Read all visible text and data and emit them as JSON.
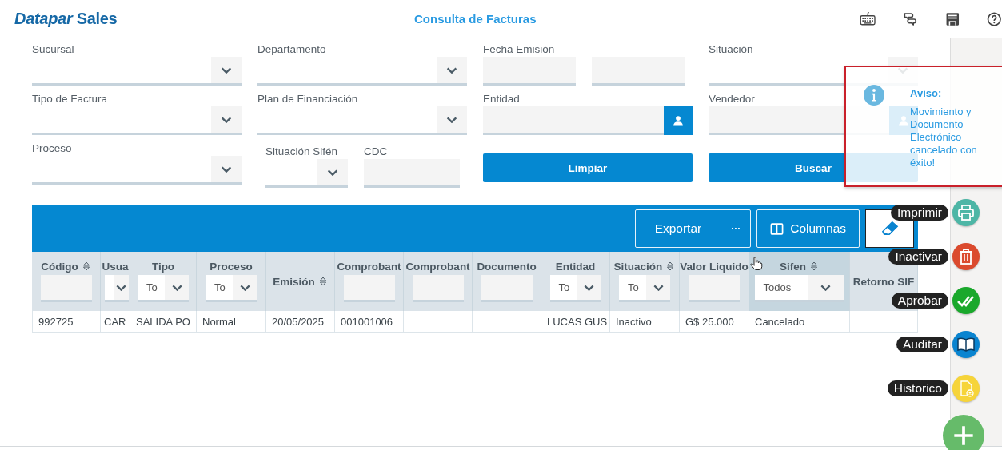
{
  "header": {
    "logo": "*Datapar* Sales",
    "title": "Consulta de Facturas"
  },
  "filters": [
    {
      "kind": "select",
      "label": "Sucursal"
    },
    {
      "kind": "select",
      "label": "Departamento"
    },
    {
      "kind": "date_range",
      "label": "Fecha Emisión"
    },
    {
      "kind": "select",
      "label": "Situación"
    },
    {
      "kind": "select",
      "label": "Tipo de Factura"
    },
    {
      "kind": "select",
      "label": "Plan de Financiación"
    },
    {
      "kind": "lookup",
      "label": "Entidad"
    },
    {
      "kind": "lookup",
      "label": "Vendedor"
    },
    {
      "kind": "select",
      "label": "Proceso"
    },
    {
      "kind": "split",
      "fields": [
        {
          "kind": "select",
          "label": "Situación Sifén"
        },
        {
          "kind": "text",
          "label": "CDC"
        }
      ]
    },
    {
      "kind": "button",
      "label": "Limpiar"
    },
    {
      "kind": "button",
      "label": "Buscar"
    }
  ],
  "toolbar": {
    "export": "Exportar",
    "more": "···",
    "columns": "Columnas"
  },
  "table": {
    "columns": [
      {
        "label": "Código",
        "sortable": true,
        "kind": "text_filter",
        "highlighted": false
      },
      {
        "label": "Usua",
        "sortable": false,
        "kind": "select_filter",
        "highlighted": false
      },
      {
        "label": "Tipo",
        "sortable": false,
        "kind": "select_filter",
        "filter_value": "To",
        "highlighted": false
      },
      {
        "label": "Proceso",
        "sortable": false,
        "kind": "select_filter",
        "filter_value": "To",
        "highlighted": false
      },
      {
        "label": "Emisión",
        "sortable": true,
        "kind": "plain",
        "highlighted": false
      },
      {
        "label": "Comprobant",
        "sortable": false,
        "kind": "text_filter",
        "highlighted": false
      },
      {
        "label": "Comprobant",
        "sortable": false,
        "kind": "text_filter",
        "highlighted": false
      },
      {
        "label": "Documento",
        "sortable": false,
        "kind": "text_filter",
        "highlighted": false
      },
      {
        "label": "Entidad",
        "sortable": false,
        "kind": "select_filter",
        "filter_value": "To",
        "highlighted": false
      },
      {
        "label": "Situación",
        "sortable": true,
        "kind": "select_filter",
        "filter_value": "To",
        "highlighted": false
      },
      {
        "label": "Valor Liquido",
        "sortable": false,
        "kind": "text_filter",
        "highlighted": false
      },
      {
        "label": "Sifen",
        "sortable": true,
        "kind": "select_filter",
        "filter_value": "Todos",
        "highlighted": true
      },
      {
        "label": "Retorno SIF",
        "sortable": false,
        "kind": "plain",
        "highlighted": false
      }
    ],
    "rows": [
      {
        "cells": [
          "992725",
          "CAR",
          "SALIDA PO",
          "Normal",
          "20/05/2025",
          "001001006",
          null,
          null,
          "LUCAS GUS",
          "Inactivo",
          "G$ 25.000",
          "Cancelado",
          null
        ]
      }
    ]
  },
  "actions": [
    {
      "label": "Imprimir",
      "color": "#4db6a6"
    },
    {
      "label": "Inactivar",
      "color": "#db4a2e"
    },
    {
      "label": "Aprobar",
      "color": "#1aa82c"
    },
    {
      "label": "Auditar",
      "color": "#0a84d0"
    },
    {
      "label": "Historico",
      "color": "#f6d43a"
    }
  ],
  "add_button": {
    "color": "#66bb6a"
  },
  "toast": {
    "title": "Aviso:",
    "message": "Movimiento y Documento Electrónico cancelado con éxito!"
  }
}
